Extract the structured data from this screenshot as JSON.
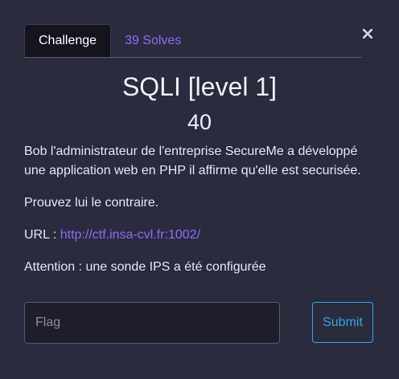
{
  "tabs": [
    {
      "label": "Challenge",
      "active": true
    },
    {
      "label": "39 Solves",
      "active": false
    }
  ],
  "close_icon": "close-icon",
  "challenge": {
    "name": "SQLI [level 1]",
    "points": "40"
  },
  "description": {
    "p1": "Bob l'administrateur de l'entreprise SecureMe a développé une application web en PHP il affirme qu'elle est securisée.",
    "p2": "Prouvez lui le contraire.",
    "url_prefix": "URL : ",
    "url": "http://ctf.insa-cvl.fr:1002/",
    "p4": "Attention : une sonde IPS a été configurée"
  },
  "form": {
    "flag_placeholder": "Flag",
    "flag_value": "",
    "submit_label": "Submit"
  },
  "colors": {
    "background": "#2b2b40",
    "link": "#8a6cf0",
    "submit": "#2fa8d8"
  }
}
